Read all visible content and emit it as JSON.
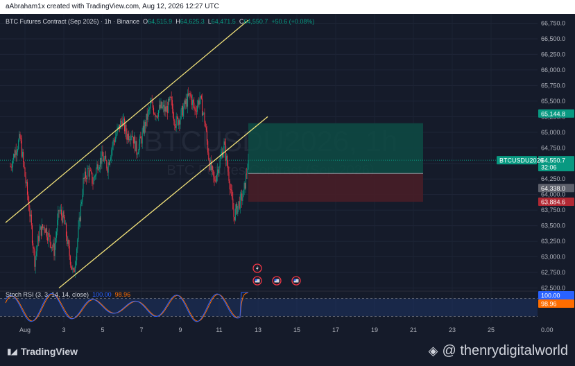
{
  "header": {
    "credit": "aAbraham1x created with TradingView.com, Aug 12, 2026 12:27 UTC"
  },
  "legend": {
    "symbol_title": "BTC Futures Contract (Sep 2026) · 1h · Binance",
    "o_label": "O",
    "o_value": "64,515.9",
    "h_label": "H",
    "h_value": "64,625.3",
    "l_label": "L",
    "l_value": "64,471.5",
    "c_label": "C",
    "c_value": "64,550.7",
    "change": "+50.6 (+0.08%)"
  },
  "watermark": {
    "main": "BTCUSDU2026, 1h",
    "sub": "BTC Futures Contract (Sep 2026)"
  },
  "colors": {
    "background": "#151b2a",
    "up": "#089981",
    "down": "#f23645",
    "trendline": "#f2e27a",
    "target_zone": "#0d4b44",
    "stop_zone": "#4a1d27",
    "stoch_k": "#2962ff",
    "stoch_d": "#ff6d00"
  },
  "price_axis": {
    "ticks": [
      "66,750.0",
      "66,500.0",
      "66,250.0",
      "66,000.0",
      "65,750.0",
      "65,500.0",
      "65,250.0",
      "65,000.0",
      "64,750.0",
      "64,500.0",
      "64,250.0",
      "64,000.0",
      "63,750.0",
      "63,500.0",
      "63,250.0",
      "63,000.0",
      "62,750.0",
      "62,500.0"
    ],
    "labels": {
      "target": "65,144.8",
      "symbol": "BTCUSDU2026",
      "last": "64,550.7",
      "countdown": "32:06",
      "entry": "64,338.0",
      "stop": "63,884.6"
    }
  },
  "time_axis": {
    "ticks": [
      "Aug",
      "3",
      "5",
      "7",
      "9",
      "11",
      "13",
      "15",
      "17",
      "19",
      "21",
      "23",
      "25"
    ]
  },
  "stoch": {
    "title": "Stoch RSI (3, 3, 14, 14, close)",
    "k_value": "100.00",
    "d_value": "98.96",
    "axis_ticks": [
      "100.00",
      "0.00"
    ],
    "upper_band": 80,
    "lower_band": 20
  },
  "footer": {
    "brand": "TradingView",
    "handle": "@ thenrydigitalworld"
  },
  "chart_data": {
    "type": "candlestick",
    "title": "BTC Futures Contract (Sep 2026) · 1h · Binance",
    "ylim": [
      62450,
      66900
    ],
    "xlim_days": [
      "Jul 31",
      "Aug 26"
    ],
    "close_path": [
      {
        "date": "Jul 31 06:00",
        "close": 64450
      },
      {
        "date": "Jul 31 12:00",
        "close": 64700
      },
      {
        "date": "Jul 31 18:00",
        "close": 64900
      },
      {
        "date": "Aug 1 00:00",
        "close": 64300
      },
      {
        "date": "Aug 1 06:00",
        "close": 63700
      },
      {
        "date": "Aug 1 12:00",
        "close": 62950
      },
      {
        "date": "Aug 1 18:00",
        "close": 63400
      },
      {
        "date": "Aug 2 00:00",
        "close": 63500
      },
      {
        "date": "Aug 2 06:00",
        "close": 63300
      },
      {
        "date": "Aug 2 12:00",
        "close": 63100
      },
      {
        "date": "Aug 2 18:00",
        "close": 63750
      },
      {
        "date": "Aug 3 00:00",
        "close": 63600
      },
      {
        "date": "Aug 3 06:00",
        "close": 63100
      },
      {
        "date": "Aug 3 12:00",
        "close": 62700
      },
      {
        "date": "Aug 3 18:00",
        "close": 63400
      },
      {
        "date": "Aug 4 00:00",
        "close": 64200
      },
      {
        "date": "Aug 4 06:00",
        "close": 64400
      },
      {
        "date": "Aug 4 12:00",
        "close": 64200
      },
      {
        "date": "Aug 4 18:00",
        "close": 64500
      },
      {
        "date": "Aug 5 00:00",
        "close": 64600
      },
      {
        "date": "Aug 5 06:00",
        "close": 64450
      },
      {
        "date": "Aug 5 12:00",
        "close": 64800
      },
      {
        "date": "Aug 5 18:00",
        "close": 65000
      },
      {
        "date": "Aug 6 00:00",
        "close": 65200
      },
      {
        "date": "Aug 6 06:00",
        "close": 64950
      },
      {
        "date": "Aug 6 12:00",
        "close": 65000
      },
      {
        "date": "Aug 6 18:00",
        "close": 64700
      },
      {
        "date": "Aug 7 00:00",
        "close": 64900
      },
      {
        "date": "Aug 7 06:00",
        "close": 65200
      },
      {
        "date": "Aug 7 12:00",
        "close": 65450
      },
      {
        "date": "Aug 7 18:00",
        "close": 65300
      },
      {
        "date": "Aug 8 00:00",
        "close": 65400
      },
      {
        "date": "Aug 8 06:00",
        "close": 65350
      },
      {
        "date": "Aug 8 12:00",
        "close": 65500
      },
      {
        "date": "Aug 8 18:00",
        "close": 65150
      },
      {
        "date": "Aug 9 00:00",
        "close": 65250
      },
      {
        "date": "Aug 9 06:00",
        "close": 65450
      },
      {
        "date": "Aug 9 12:00",
        "close": 65600
      },
      {
        "date": "Aug 9 18:00",
        "close": 65350
      },
      {
        "date": "Aug 10 00:00",
        "close": 65550
      },
      {
        "date": "Aug 10 06:00",
        "close": 65200
      },
      {
        "date": "Aug 10 12:00",
        "close": 64500
      },
      {
        "date": "Aug 10 18:00",
        "close": 64200
      },
      {
        "date": "Aug 11 00:00",
        "close": 64500
      },
      {
        "date": "Aug 11 06:00",
        "close": 64800
      },
      {
        "date": "Aug 11 12:00",
        "close": 64300
      },
      {
        "date": "Aug 11 18:00",
        "close": 63650
      },
      {
        "date": "Aug 12 00:00",
        "close": 63850
      },
      {
        "date": "Aug 12 06:00",
        "close": 64000
      },
      {
        "date": "Aug 12 12:00",
        "close": 64550.7
      }
    ],
    "trendlines": [
      {
        "name": "upper",
        "from": {
          "date": "Jul 31 00:00",
          "price": 63550
        },
        "to": {
          "date": "Aug 12 12:00",
          "price": 66800
        }
      },
      {
        "name": "lower",
        "from": {
          "date": "Aug 2 18:00",
          "price": 62500
        },
        "to": {
          "date": "Aug 13 12:00",
          "price": 65250
        }
      }
    ],
    "long_position": {
      "start": "Aug 12 12:00",
      "end": "Aug 21 12:00",
      "entry": 64338.0,
      "target": 65144.8,
      "stop": 63884.6,
      "last": 64550.7
    },
    "event_markers": [
      {
        "date": "Aug 12 18:00",
        "kind": "flash"
      },
      {
        "date": "Aug 12 18:00",
        "kind": "economic"
      },
      {
        "date": "Aug 13 18:00",
        "kind": "economic"
      },
      {
        "date": "Aug 14 18:00",
        "kind": "economic"
      }
    ],
    "stoch_rsi": {
      "k_last": 100.0,
      "d_last": 98.96,
      "bands": [
        20,
        80
      ],
      "ylim": [
        0,
        100
      ]
    }
  }
}
